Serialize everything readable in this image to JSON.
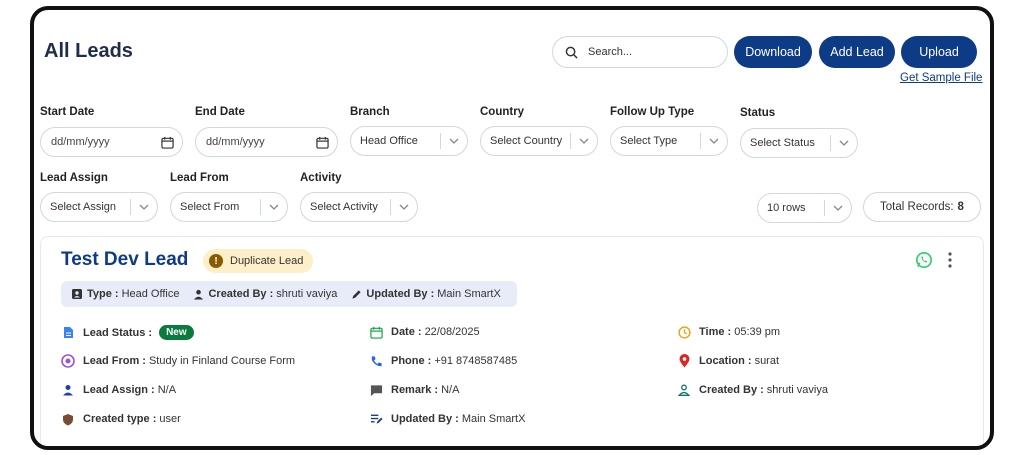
{
  "header": {
    "title": "All Leads",
    "search_placeholder": "Search...",
    "download_label": "Download",
    "add_lead_label": "Add Lead",
    "upload_label": "Upload",
    "sample_link": "Get Sample File"
  },
  "filters": {
    "start_date": {
      "label": "Start Date",
      "value": "dd/mm/yyyy"
    },
    "end_date": {
      "label": "End Date",
      "value": "dd/mm/yyyy"
    },
    "branch": {
      "label": "Branch",
      "value": "Head Office"
    },
    "country": {
      "label": "Country",
      "value": "Select Country"
    },
    "follow_up_type": {
      "label": "Follow Up Type",
      "value": "Select Type"
    },
    "status": {
      "label": "Status",
      "value": "Select Status"
    },
    "lead_assign": {
      "label": "Lead Assign",
      "value": "Select Assign"
    },
    "lead_from": {
      "label": "Lead From",
      "value": "Select From"
    },
    "activity": {
      "label": "Activity",
      "value": "Select Activity"
    },
    "rows": {
      "value": "10 rows"
    },
    "total_records": {
      "label": "Total Records:",
      "value": "8"
    }
  },
  "lead": {
    "name": "Test Dev Lead",
    "badge": "Duplicate Lead",
    "info_bar": {
      "type_label": "Type :",
      "type_value": "Head Office",
      "created_by_label": "Created By :",
      "created_by_value": "shruti vaviya",
      "updated_by_label": "Updated By :",
      "updated_by_value": "Main SmartX"
    },
    "fields": {
      "lead_status_label": "Lead Status :",
      "lead_status_value": "New",
      "lead_from_label": "Lead From :",
      "lead_from_value": "Study in Finland Course Form",
      "lead_assign_label": "Lead Assign :",
      "lead_assign_value": "N/A",
      "created_type_label": "Created type :",
      "created_type_value": "user",
      "date_label": "Date :",
      "date_value": "22/08/2025",
      "phone_label": "Phone :",
      "phone_value": "+91 8748587485",
      "remark_label": "Remark :",
      "remark_value": "N/A",
      "updated_by_label": "Updated By :",
      "updated_by_value": "Main SmartX",
      "time_label": "Time :",
      "time_value": "05:39 pm",
      "location_label": "Location :",
      "location_value": "surat",
      "created_by_label": "Created By :",
      "created_by_value": "shruti vaviya"
    }
  },
  "colors": {
    "primary": "#0d3b86",
    "title": "#1f2d4d",
    "new_badge": "#0b7a3e",
    "duplicate_badge_bg": "#fdf0c8",
    "whatsapp": "#25d366"
  }
}
